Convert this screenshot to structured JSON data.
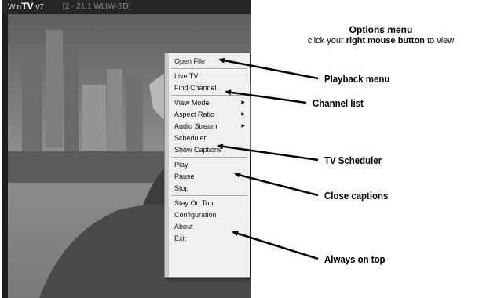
{
  "window": {
    "app_name_prefix": "Win",
    "app_name_bold": "TV",
    "app_name_suffix": "v7",
    "channel_info": "[2 - 21.1   WLIW-SD]"
  },
  "context_menu": {
    "groups": [
      [
        {
          "label": "Open File"
        }
      ],
      [
        {
          "label": "Live TV"
        },
        {
          "label": "Find Channel"
        }
      ],
      [
        {
          "label": "View Mode",
          "submenu": true
        },
        {
          "label": "Aspect Ratio",
          "submenu": true
        },
        {
          "label": "Audio Stream",
          "submenu": true
        },
        {
          "label": "Scheduler"
        },
        {
          "label": "Show Captions"
        }
      ],
      [
        {
          "label": "Play"
        },
        {
          "label": "Pause"
        },
        {
          "label": "Stop"
        }
      ],
      [
        {
          "label": "Stay On Top"
        },
        {
          "label": "Configuration"
        },
        {
          "label": "About"
        },
        {
          "label": "Exit"
        }
      ]
    ],
    "submenu_glyph": "▶"
  },
  "annotations": {
    "header_title": "Options menu",
    "header_text_before": "click your ",
    "header_text_bold": "right mouse button",
    "header_text_after": " to view",
    "callouts": [
      {
        "text": "Playback menu"
      },
      {
        "text": "Channel list"
      },
      {
        "text": "TV Scheduler"
      },
      {
        "text": "Close captions"
      },
      {
        "text": "Always on top"
      }
    ]
  }
}
